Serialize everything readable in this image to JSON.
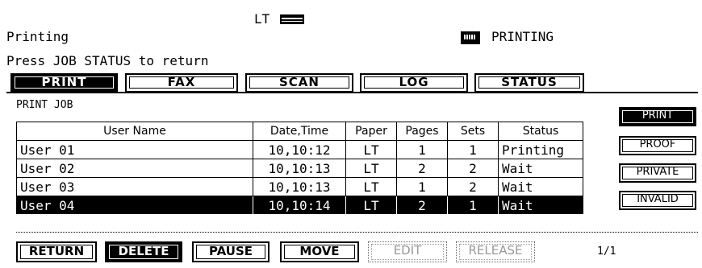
{
  "status_bar": {
    "paper_size": "LT",
    "left_status": "Printing",
    "hint": "Press JOB STATUS to return",
    "right_status": "PRINTING"
  },
  "tabs": [
    {
      "label": "PRINT",
      "active": true
    },
    {
      "label": "FAX",
      "active": false
    },
    {
      "label": "SCAN",
      "active": false
    },
    {
      "label": "LOG",
      "active": false
    },
    {
      "label": "STATUS",
      "active": false
    }
  ],
  "panel": {
    "title": "PRINT JOB",
    "columns": [
      "User Name",
      "Date,Time",
      "Paper",
      "Pages",
      "Sets",
      "Status"
    ],
    "rows": [
      [
        "User 01",
        "10,10:12",
        "LT",
        "1",
        "1",
        "Printing"
      ],
      [
        "User 02",
        "10,10:13",
        "LT",
        "2",
        "2",
        "Wait"
      ],
      [
        "User 03",
        "10,10:13",
        "LT",
        "1",
        "2",
        "Wait"
      ],
      [
        "User 04",
        "10,10:14",
        "LT",
        "2",
        "1",
        "Wait"
      ]
    ],
    "selected_row": 3
  },
  "side_buttons": [
    {
      "label": "PRINT",
      "active": true
    },
    {
      "label": "PROOF",
      "active": false
    },
    {
      "label": "PRIVATE",
      "active": false
    },
    {
      "label": "INVALID",
      "active": false
    }
  ],
  "bottom_buttons": [
    {
      "label": "RETURN",
      "active": false,
      "enabled": true
    },
    {
      "label": "DELETE",
      "active": true,
      "enabled": true
    },
    {
      "label": "PAUSE",
      "active": false,
      "enabled": true
    },
    {
      "label": "MOVE",
      "active": false,
      "enabled": true
    },
    {
      "label": "EDIT",
      "active": false,
      "enabled": false
    },
    {
      "label": "RELEASE",
      "active": false,
      "enabled": false
    }
  ],
  "page_indicator": "1/1",
  "icons": {
    "paper": "paper-tray-icon",
    "printer": "printer-icon"
  }
}
